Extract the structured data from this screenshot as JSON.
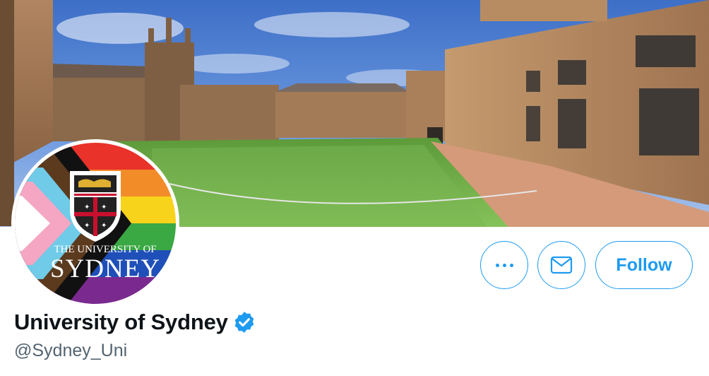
{
  "profile": {
    "name": "University of Sydney",
    "handle": "@Sydney_Uni",
    "verified": true
  },
  "avatar": {
    "logo_line1": "THE UNIVERSITY OF",
    "logo_line2": "SYDNEY",
    "flag_colors": [
      "#e8322a",
      "#f28c28",
      "#f7d31b",
      "#3aa843",
      "#1f4fb8",
      "#7a2a8f"
    ],
    "chevron_colors": [
      "#ffffff",
      "#f4a6c2",
      "#6fcbe8",
      "#5b3a1e",
      "#111111"
    ]
  },
  "actions": {
    "more_icon": "more-dots-icon",
    "message_icon": "envelope-icon",
    "follow_label": "Follow"
  },
  "theme": {
    "accent": "#1d9bf0",
    "text": "#0f1419",
    "secondary_text": "#536471"
  }
}
